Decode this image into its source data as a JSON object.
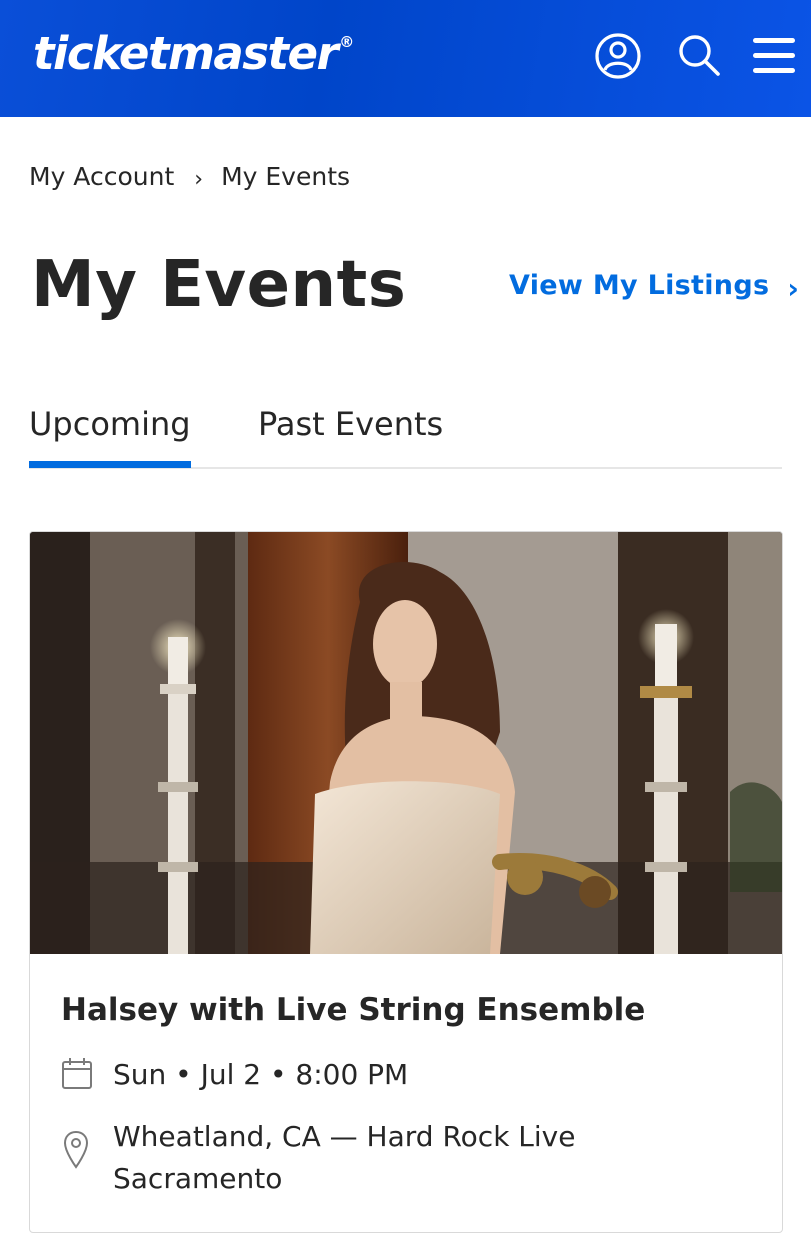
{
  "brand": {
    "logo_text": "ticketmaster",
    "logo_mark": "®",
    "color": "#0a4fd8",
    "accent": "#026cdf"
  },
  "header": {
    "icons": [
      "account-icon",
      "search-icon",
      "menu-icon"
    ]
  },
  "breadcrumb": {
    "items": [
      "My Account",
      "My Events"
    ],
    "separator": "›"
  },
  "page": {
    "title": "My Events",
    "listings_link": "View My Listings",
    "listings_chevron": "›"
  },
  "tabs": [
    {
      "label": "Upcoming",
      "active": true
    },
    {
      "label": "Past Events",
      "active": false
    }
  ],
  "event": {
    "title": "Halsey with Live String Ensemble",
    "date": "Sun • Jul 2 • 8:00 PM",
    "venue": "Wheatland, CA — Hard Rock Live Sacramento"
  }
}
